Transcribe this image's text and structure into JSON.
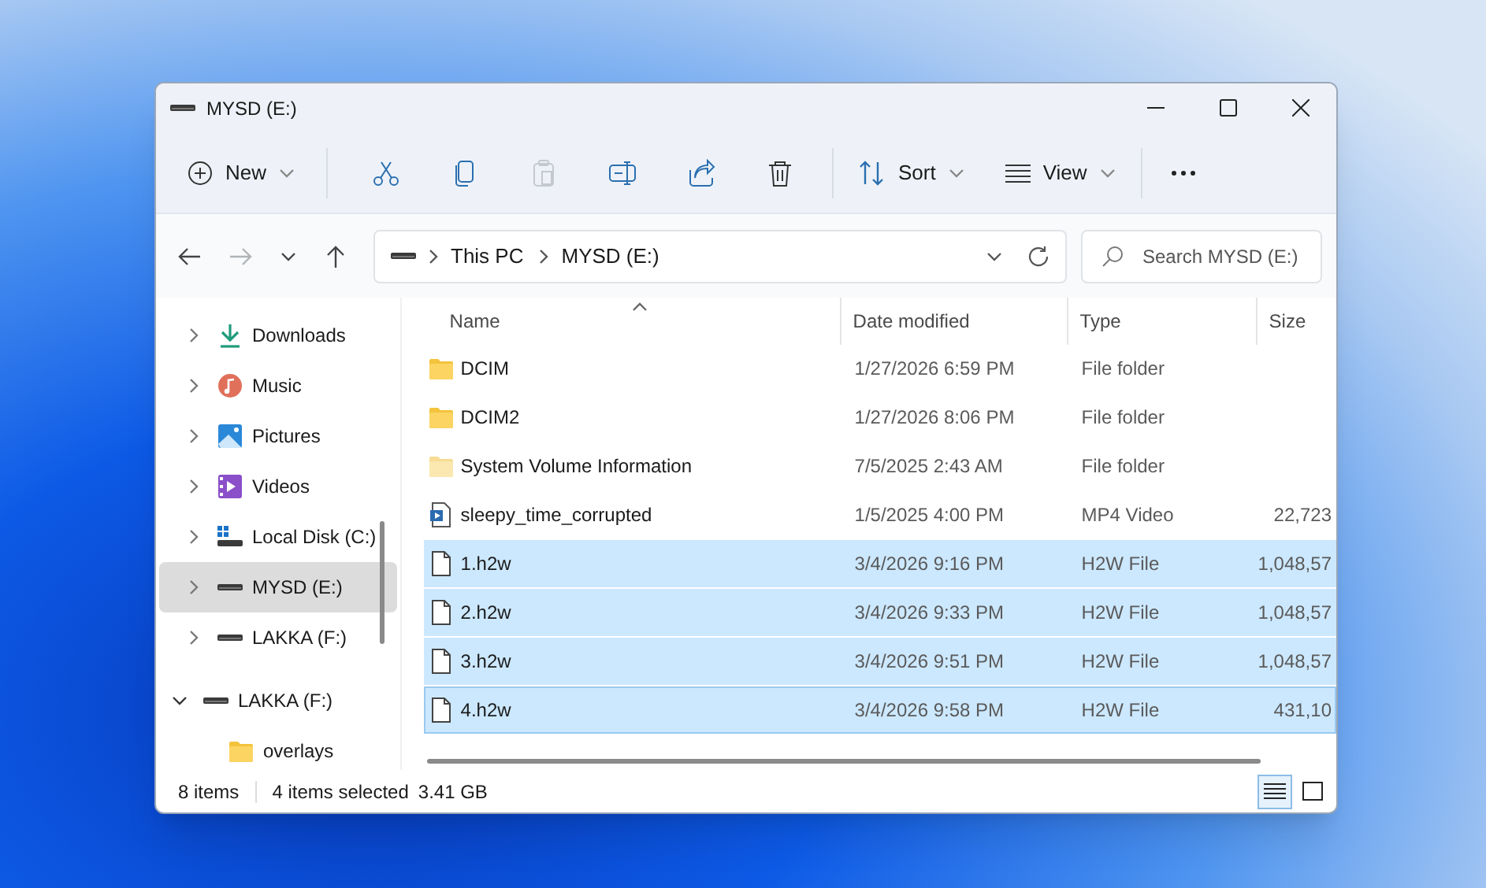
{
  "window": {
    "title": "MYSD (E:)"
  },
  "toolbar": {
    "new_label": "New",
    "sort_label": "Sort",
    "view_label": "View",
    "actions": [
      {
        "kind": "cut",
        "disabled": false
      },
      {
        "kind": "copy",
        "disabled": false
      },
      {
        "kind": "paste",
        "disabled": true
      },
      {
        "kind": "rename",
        "disabled": false
      },
      {
        "kind": "share",
        "disabled": false
      },
      {
        "kind": "delete",
        "disabled": false
      }
    ]
  },
  "navigation": {
    "back_disabled": false,
    "forward_disabled": true
  },
  "address": {
    "path": [
      "This PC",
      "MYSD (E:)"
    ]
  },
  "search": {
    "placeholder": "Search MYSD (E:)"
  },
  "sidebar": {
    "items": [
      {
        "kind": "download",
        "label": "Downloads",
        "expanded": false,
        "selected": false
      },
      {
        "kind": "music",
        "label": "Music",
        "expanded": false,
        "selected": false
      },
      {
        "kind": "pictures",
        "label": "Pictures",
        "expanded": false,
        "selected": false
      },
      {
        "kind": "videos",
        "label": "Videos",
        "expanded": false,
        "selected": false
      },
      {
        "kind": "system-drive",
        "label": "Local Disk (C:)",
        "expanded": false,
        "selected": false
      },
      {
        "kind": "drive",
        "label": "MYSD (E:)",
        "expanded": false,
        "selected": true
      },
      {
        "kind": "drive",
        "label": "LAKKA (F:)",
        "expanded": false,
        "selected": false
      },
      {
        "kind": "drive",
        "label": "LAKKA (F:)",
        "expanded": true,
        "selected": false,
        "children": [
          {
            "kind": "folder",
            "label": "overlays",
            "selected": false
          }
        ]
      }
    ]
  },
  "table": {
    "columns": [
      {
        "label": "Name",
        "sorted": true
      },
      {
        "label": "Date modified",
        "sorted": false
      },
      {
        "label": "Type",
        "sorted": false
      },
      {
        "label": "Size",
        "sorted": false
      }
    ],
    "rows": [
      {
        "kind": "folder",
        "name": "DCIM",
        "date": "1/27/2026 6:59 PM",
        "type": "File folder",
        "selected": false,
        "focused": false
      },
      {
        "kind": "folder",
        "name": "DCIM2",
        "date": "1/27/2026 8:06 PM",
        "type": "File folder",
        "selected": false,
        "focused": false
      },
      {
        "kind": "system-folder",
        "name": "System Volume Information",
        "date": "7/5/2025 2:43 AM",
        "type": "File folder",
        "selected": false,
        "focused": false
      },
      {
        "kind": "video",
        "name": "sleepy_time_corrupted",
        "date": "1/5/2025 4:00 PM",
        "type": "MP4 Video",
        "size": "22,723",
        "selected": false,
        "focused": false
      },
      {
        "kind": "file",
        "name": "1.h2w",
        "date": "3/4/2026 9:16 PM",
        "type": "H2W File",
        "size": "1,048,57",
        "selected": true,
        "focused": false
      },
      {
        "kind": "file",
        "name": "2.h2w",
        "date": "3/4/2026 9:33 PM",
        "type": "H2W File",
        "size": "1,048,57",
        "selected": true,
        "focused": false
      },
      {
        "kind": "file",
        "name": "3.h2w",
        "date": "3/4/2026 9:51 PM",
        "type": "H2W File",
        "size": "1,048,57",
        "selected": true,
        "focused": false
      },
      {
        "kind": "file",
        "name": "4.h2w",
        "date": "3/4/2026 9:58 PM",
        "type": "H2W File",
        "size": "431,10",
        "selected": true,
        "focused": true
      }
    ]
  },
  "status_bar": {
    "item_count": "8 items",
    "selection": "4 items selected",
    "size": "3.41 GB",
    "views": [
      {
        "kind": "details",
        "selected": true
      },
      {
        "kind": "tiles",
        "selected": false
      }
    ]
  }
}
